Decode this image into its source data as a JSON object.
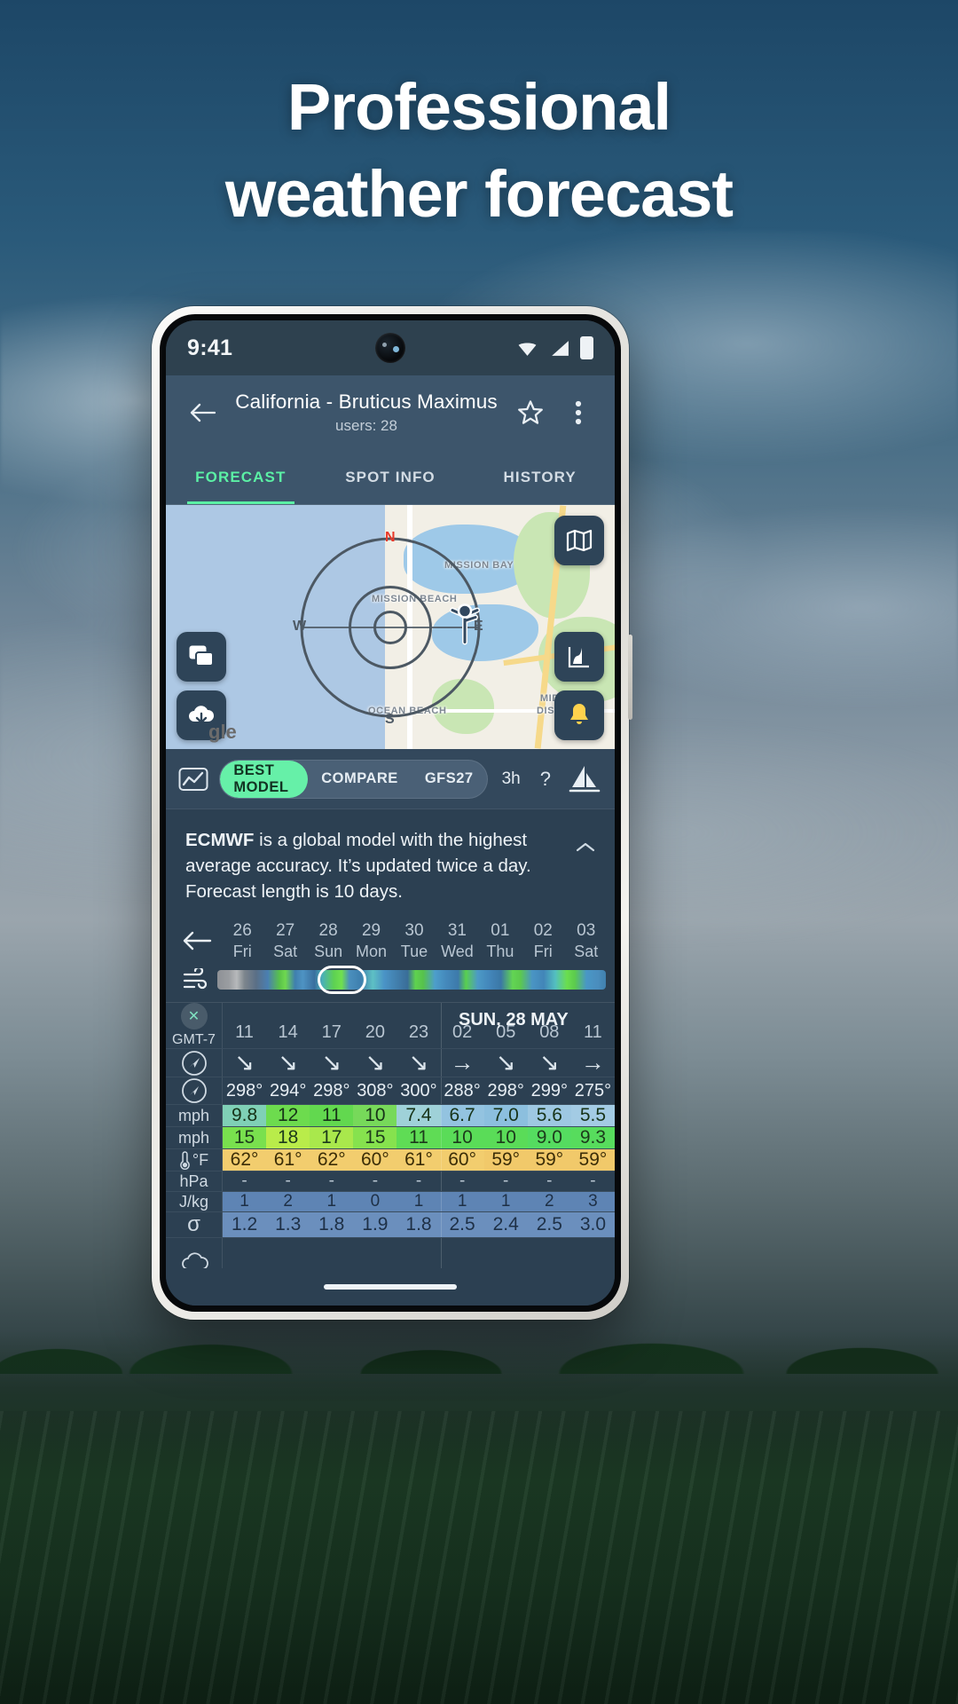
{
  "headline": {
    "line1": "Professional",
    "line2": "weather forecast"
  },
  "status_bar": {
    "time": "9:41",
    "wifi_icon": "wifi-icon",
    "signal_icon": "signal-icon",
    "battery_icon": "battery-icon"
  },
  "app_bar": {
    "back_icon": "back-arrow-icon",
    "title": "California - Bruticus Maximus",
    "subtitle": "users: 28",
    "favorite_icon": "star-icon",
    "overflow_icon": "more-vertical-icon"
  },
  "tabs": [
    {
      "label": "FORECAST",
      "active": true
    },
    {
      "label": "SPOT INFO",
      "active": false
    },
    {
      "label": "HISTORY",
      "active": false
    }
  ],
  "map": {
    "compass": {
      "n": "N",
      "e": "E",
      "s": "S",
      "w": "W"
    },
    "labels": [
      "MISSION BAY",
      "MISSION BEACH",
      "OCEAN BEACH",
      "MIDWAY DISTRICT"
    ],
    "attribution": "gle",
    "buttons": [
      {
        "name": "map-layers-button",
        "icon": "map-icon"
      },
      {
        "name": "chat-button",
        "icon": "chat-icon"
      },
      {
        "name": "download-button",
        "icon": "cloud-download-icon"
      },
      {
        "name": "chart-button",
        "icon": "chart-icon"
      },
      {
        "name": "alerts-button",
        "icon": "bell-icon"
      }
    ]
  },
  "model_bar": {
    "chart_icon": "line-chart-icon",
    "segments": [
      {
        "label": "BEST MODEL",
        "active": true
      },
      {
        "label": "COMPARE",
        "active": false
      },
      {
        "label": "GFS27",
        "active": false
      }
    ],
    "interval": "3h",
    "help": "?",
    "sail_icon": "sail-icon"
  },
  "description": {
    "model": "ECMWF",
    "text": " is a global model with the highest average accuracy. It’s updated twice a day. Forecast length is 10 days.",
    "collapse_icon": "chevron-up-icon"
  },
  "day_strip": {
    "back_icon": "left-arrow-icon",
    "wind_icon": "wind-icon",
    "days": [
      {
        "date": "26",
        "weekday": "Fri"
      },
      {
        "date": "27",
        "weekday": "Sat"
      },
      {
        "date": "28",
        "weekday": "Sun"
      },
      {
        "date": "29",
        "weekday": "Mon"
      },
      {
        "date": "30",
        "weekday": "Tue"
      },
      {
        "date": "31",
        "weekday": "Wed"
      },
      {
        "date": "01",
        "weekday": "Thu"
      },
      {
        "date": "02",
        "weekday": "Fri"
      },
      {
        "date": "03",
        "weekday": "Sat"
      }
    ],
    "selected_index": 2
  },
  "forecast_table": {
    "close_icon": "close-circle-icon",
    "timezone": "GMT-7",
    "day_header": "SUN, 28 MAY",
    "day_break_after_index": 4,
    "compass_icon": "navigation-icon",
    "thermometer_icon": "thermometer-icon",
    "cloud_icon": "cloud-icon",
    "hours": [
      "11",
      "14",
      "17",
      "20",
      "23",
      "02",
      "05",
      "08",
      "11"
    ],
    "rows": [
      {
        "label": "",
        "icon": "wind-direction-arrow-icon",
        "type": "arrows",
        "values": [
          "↘",
          "↘",
          "↘",
          "↘",
          "↘",
          "→",
          "↘",
          "↘",
          "→"
        ]
      },
      {
        "label": "",
        "icon": "navigation-icon",
        "type": "degrees",
        "values": [
          "298°",
          "294°",
          "298°",
          "308°",
          "300°",
          "288°",
          "298°",
          "299°",
          "275°"
        ]
      },
      {
        "label": "mph",
        "type": "wind",
        "values": [
          "9.8",
          "12",
          "11",
          "10",
          "7.4",
          "6.7",
          "7.0",
          "5.6",
          "5.5"
        ],
        "colors": [
          "#7fd0b6",
          "#6ddb4e",
          "#62d84f",
          "#77d95a",
          "#9fd1d8",
          "#93c3e0",
          "#8cbfde",
          "#9ec8e2",
          "#a3cbe4"
        ]
      },
      {
        "label": "mph",
        "type": "gust",
        "values": [
          "15",
          "18",
          "17",
          "15",
          "11",
          "10",
          "10",
          "9.0",
          "9.3"
        ],
        "colors": [
          "#79e04e",
          "#b9ec4a",
          "#a9e84c",
          "#86e24e",
          "#5fdc55",
          "#5adc58",
          "#5adc58",
          "#55dc60",
          "#57dc5d"
        ]
      },
      {
        "label": "°F",
        "icon": "thermometer-icon",
        "type": "temp",
        "values": [
          "62°",
          "61°",
          "62°",
          "60°",
          "61°",
          "60°",
          "59°",
          "59°",
          "59°"
        ],
        "colors": [
          "#f2cd6e",
          "#f2cd6e",
          "#f2cd6e",
          "#f2cd6e",
          "#f2cd6e",
          "#f2cd6e",
          "#f1c96a",
          "#f1c96a",
          "#f1c96a"
        ]
      },
      {
        "label": "hPa",
        "type": "plain",
        "values": [
          "-",
          "-",
          "-",
          "-",
          "-",
          "-",
          "-",
          "-",
          "-"
        ]
      },
      {
        "label": "J/kg",
        "type": "jkg",
        "values": [
          "1",
          "2",
          "1",
          "0",
          "1",
          "1",
          "1",
          "2",
          "3"
        ],
        "colors": [
          "#5e84b4",
          "#5e84b4",
          "#5e84b4",
          "#5e84b4",
          "#5e84b4",
          "#5e84b4",
          "#5e84b4",
          "#5e84b4",
          "#5e84b4"
        ]
      },
      {
        "label": "σ",
        "type": "sigma",
        "values": [
          "1.2",
          "1.3",
          "1.8",
          "1.9",
          "1.8",
          "2.5",
          "2.4",
          "2.5",
          "3.0"
        ],
        "colors": [
          "#6b8fbd",
          "#6b8fbd",
          "#6b8fbd",
          "#6b8fbd",
          "#6b8fbd",
          "#6b8fbd",
          "#6b8fbd",
          "#6b8fbd",
          "#6b8fbd"
        ]
      },
      {
        "label": "",
        "icon": "cloud-icon",
        "type": "clouds",
        "values": [
          "",
          "",
          "",
          "",
          "",
          "",
          "",
          "",
          ""
        ]
      }
    ]
  },
  "colors": {
    "accent": "#5bf0a5",
    "appbar": "#3d556b",
    "surface": "#2c4052",
    "statusbar": "#2e414f",
    "north_red": "#e8392a"
  }
}
